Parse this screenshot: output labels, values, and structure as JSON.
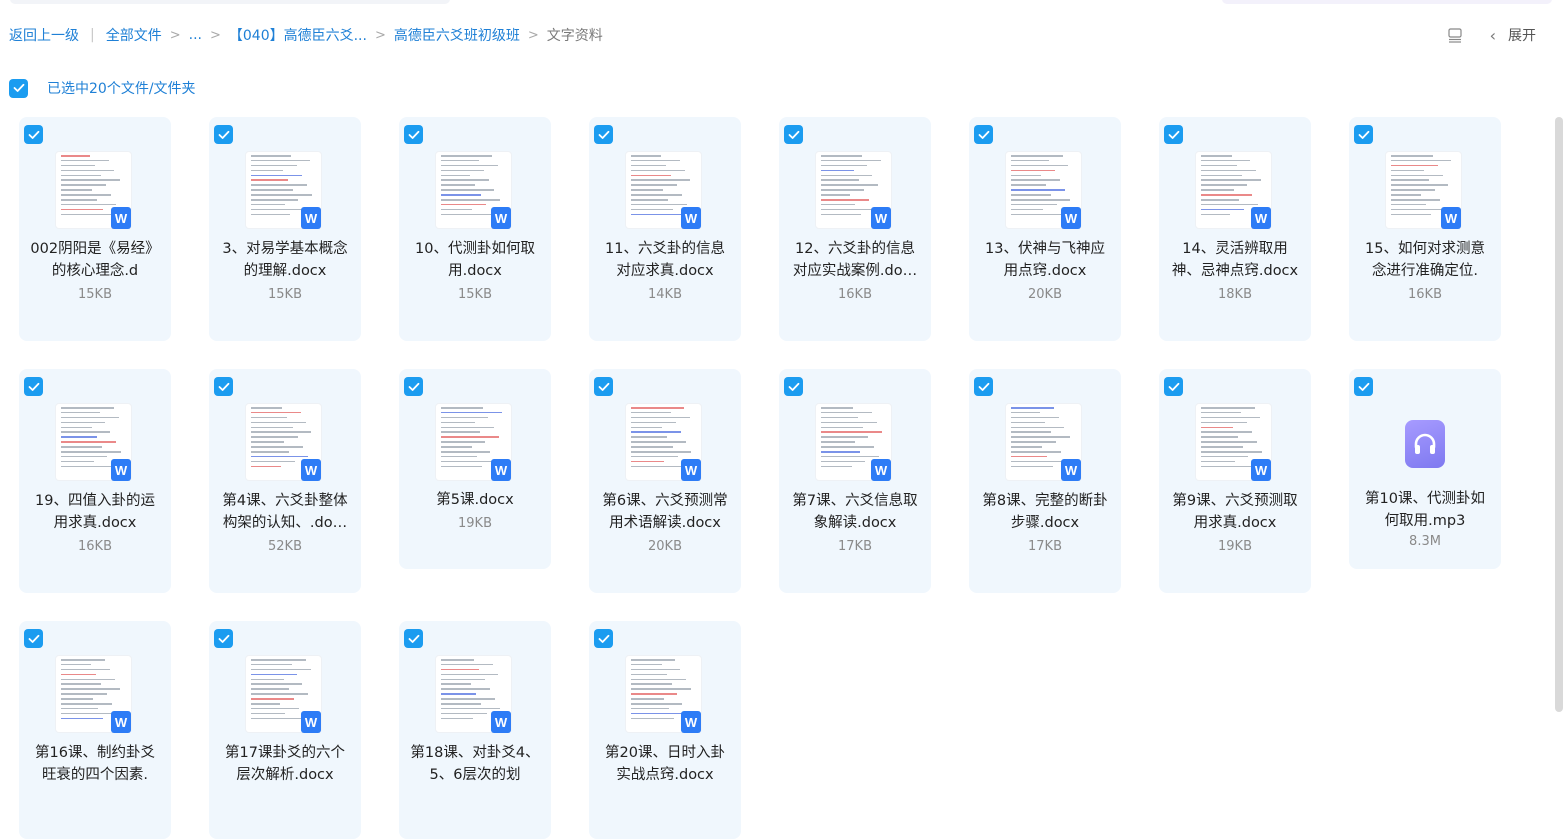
{
  "breadcrumb": {
    "back": "返回上一级",
    "all_files": "全部文件",
    "ellipsis": "...",
    "level1": "【040】高德臣六爻...",
    "level2": "高德臣六爻班初级班",
    "current": "文字资料"
  },
  "toolbar": {
    "expand_label": "展开"
  },
  "selection": {
    "label": "已选中20个文件/文件夹"
  },
  "icons": {
    "check": "check-icon",
    "word": "word-doc-icon",
    "audio": "audio-file-icon",
    "layout": "list-layout-icon",
    "collapse": "chevron-left-icon"
  },
  "colors": {
    "accent": "#1b9cf0",
    "link": "#1f80d6",
    "card_bg": "#f0f7fd",
    "word": "#2d7cf6",
    "audio": "#8a82f5"
  },
  "files": [
    {
      "name": "002阴阳是《易经》的核心理念.d",
      "size": "15KB",
      "type": "docx"
    },
    {
      "name": "3、对易学基本概念的理解.docx",
      "size": "15KB",
      "type": "docx"
    },
    {
      "name": "10、代测卦如何取用.docx",
      "size": "15KB",
      "type": "docx"
    },
    {
      "name": "11、六爻卦的信息对应求真.docx",
      "size": "14KB",
      "type": "docx"
    },
    {
      "name": "12、六爻卦的信息对应实战案例.do…",
      "size": "16KB",
      "type": "docx"
    },
    {
      "name": "13、伏神与飞神应用点窍.docx",
      "size": "20KB",
      "type": "docx"
    },
    {
      "name": "14、灵活辨取用神、忌神点窍.docx",
      "size": "18KB",
      "type": "docx"
    },
    {
      "name": "15、如何对求测意念进行准确定位.",
      "size": "16KB",
      "type": "docx"
    },
    {
      "name": "19、四值入卦的运用求真.docx",
      "size": "16KB",
      "type": "docx"
    },
    {
      "name": "第4课、六爻卦整体构架的认知、.do…",
      "size": "52KB",
      "type": "docx"
    },
    {
      "name": "第5课.docx",
      "size": "19KB",
      "type": "docx"
    },
    {
      "name": "第6课、六爻预测常用术语解读.docx",
      "size": "20KB",
      "type": "docx"
    },
    {
      "name": "第7课、六爻信息取象解读.docx",
      "size": "17KB",
      "type": "docx"
    },
    {
      "name": "第8课、完整的断卦步骤.docx",
      "size": "17KB",
      "type": "docx"
    },
    {
      "name": "第9课、六爻预测取用求真.docx",
      "size": "19KB",
      "type": "docx"
    },
    {
      "name": "第10课、代测卦如何取用.mp3",
      "size": "8.3M",
      "type": "mp3"
    },
    {
      "name": "第16课、制约卦爻旺衰的四个因素.",
      "size": "",
      "type": "docx"
    },
    {
      "name": "第17课卦爻的六个层次解析.docx",
      "size": "",
      "type": "docx"
    },
    {
      "name": "第18课、对卦爻4、5、6层次的划",
      "size": "",
      "type": "docx"
    },
    {
      "name": "第20课、日时入卦实战点窍.docx",
      "size": "",
      "type": "docx"
    }
  ]
}
